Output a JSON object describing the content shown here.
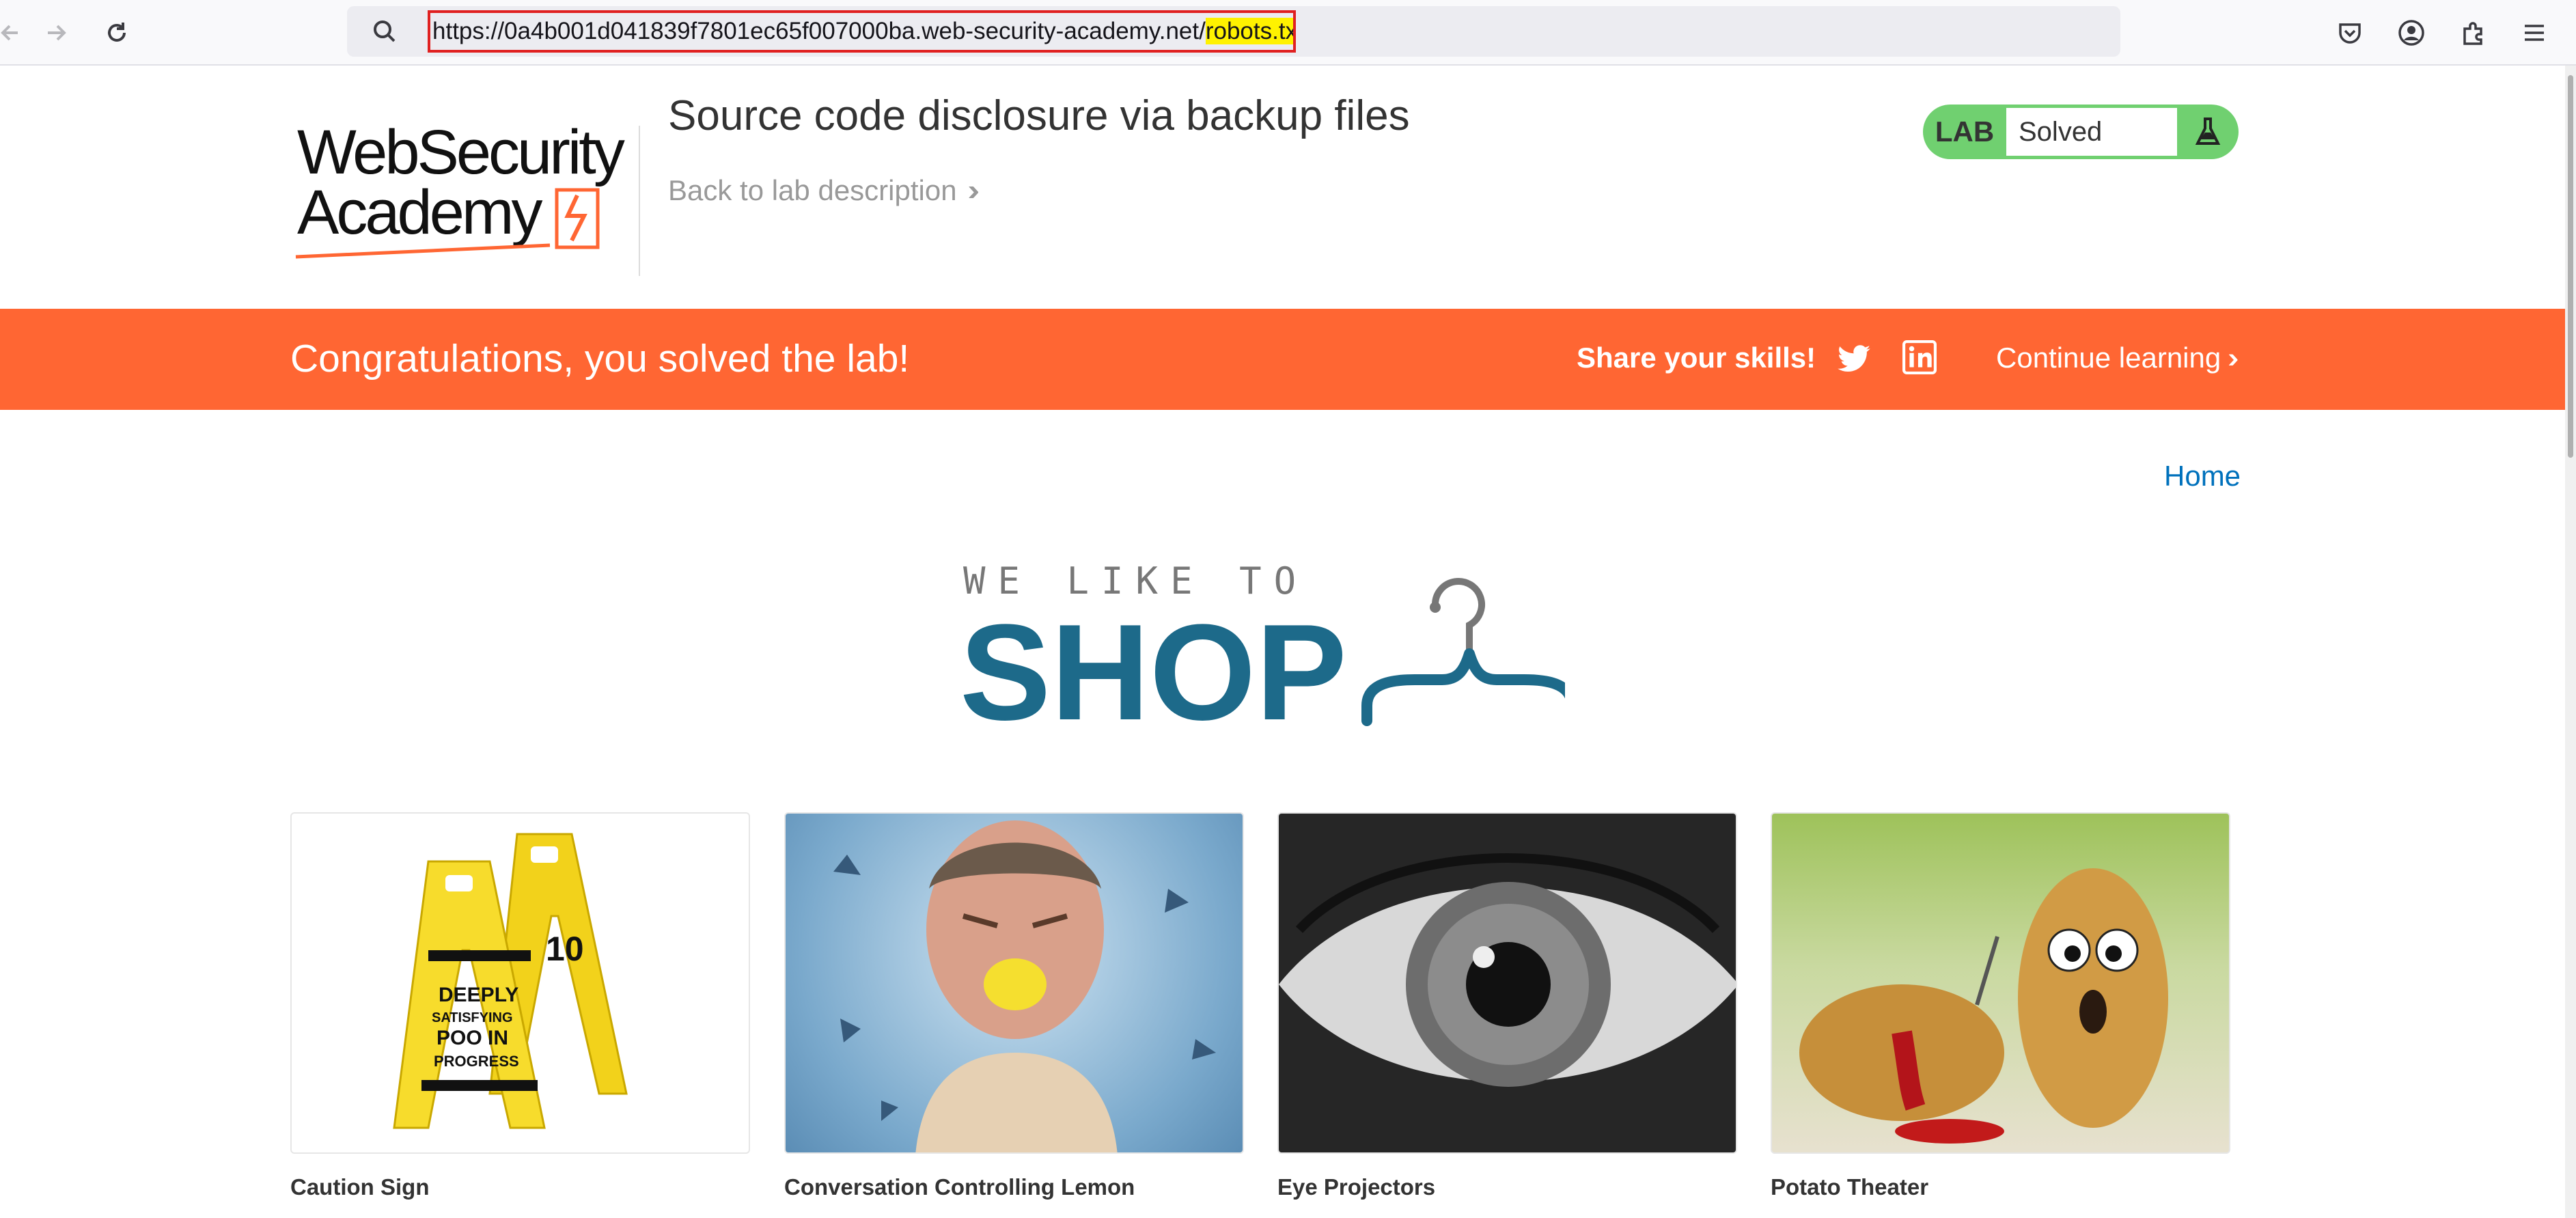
{
  "browser": {
    "url_base": "https://0a4b001d041839f7801ec65f007000ba.web-security-academy.net/",
    "url_highlight": "robots.txt"
  },
  "header": {
    "logo_line1": "WebSecurity",
    "logo_line2": "Academy",
    "lab_title": "Source code disclosure via backup files",
    "back_link": "Back to lab description",
    "status_label": "LAB",
    "status_value": "Solved"
  },
  "banner": {
    "message": "Congratulations, you solved the lab!",
    "share_label": "Share your skills!",
    "continue_label": "Continue learning"
  },
  "nav": {
    "home": "Home"
  },
  "shop": {
    "tagline": "WE LIKE TO",
    "word": "SHOP"
  },
  "products": [
    {
      "name": "Caution Sign"
    },
    {
      "name": "Conversation Controlling Lemon"
    },
    {
      "name": "Eye Projectors"
    },
    {
      "name": "Potato Theater"
    }
  ],
  "colors": {
    "brand_orange": "#ff6633",
    "status_green": "#70d070",
    "link_blue": "#0071bc",
    "shop_blue": "#1d6a8a"
  }
}
